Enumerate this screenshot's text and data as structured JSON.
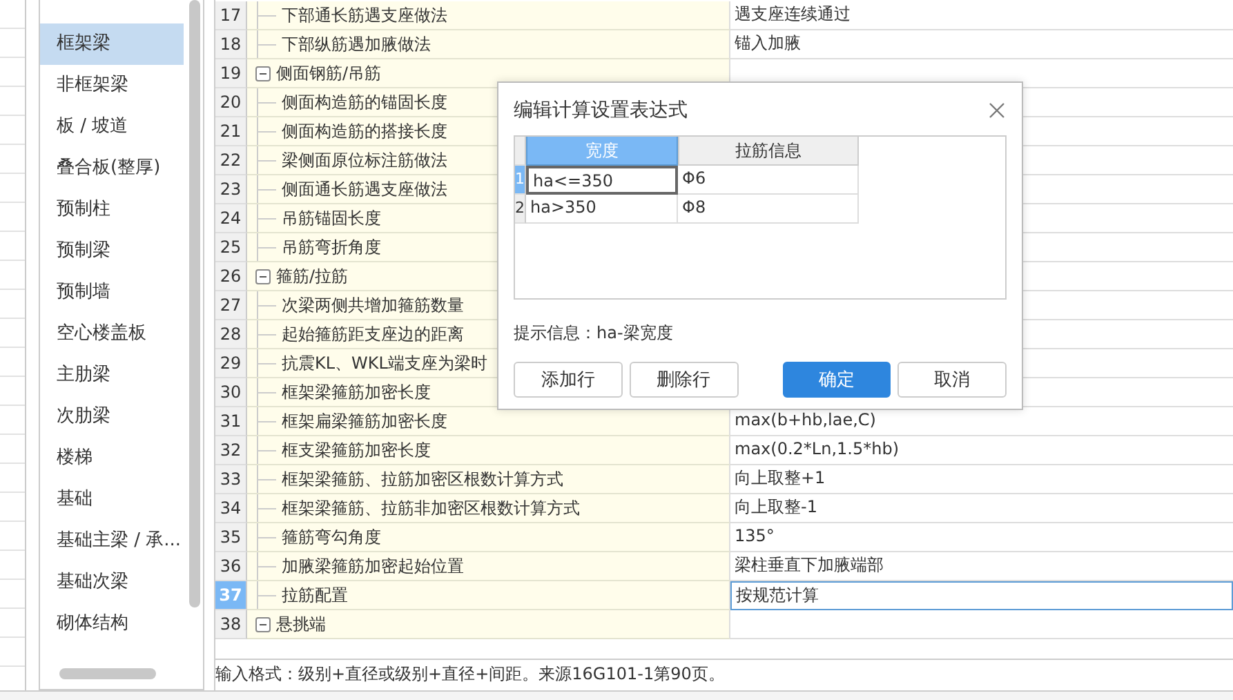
{
  "sidebar": {
    "items": [
      {
        "label": "框架梁",
        "selected": true
      },
      {
        "label": "非框架梁",
        "selected": false
      },
      {
        "label": "板 / 坡道",
        "selected": false
      },
      {
        "label": "叠合板(整厚)",
        "selected": false
      },
      {
        "label": "预制柱",
        "selected": false
      },
      {
        "label": "预制梁",
        "selected": false
      },
      {
        "label": "预制墙",
        "selected": false
      },
      {
        "label": "空心楼盖板",
        "selected": false
      },
      {
        "label": "主肋梁",
        "selected": false
      },
      {
        "label": "次肋梁",
        "selected": false
      },
      {
        "label": "楼梯",
        "selected": false
      },
      {
        "label": "基础",
        "selected": false
      },
      {
        "label": "基础主梁 / 承...",
        "selected": false
      },
      {
        "label": "基础次梁",
        "selected": false
      },
      {
        "label": "砌体结构",
        "selected": false
      }
    ]
  },
  "table": {
    "rows": [
      {
        "number": "17",
        "kind": "item",
        "name": "下部通长筋遇支座做法",
        "value": "遇支座连续通过",
        "selected": false
      },
      {
        "number": "18",
        "kind": "item",
        "name": "下部纵筋遇加腋做法",
        "value": "锚入加腋",
        "selected": false
      },
      {
        "number": "19",
        "kind": "group",
        "expanded": true,
        "name": "侧面钢筋/吊筋",
        "value": "",
        "selected": false
      },
      {
        "number": "20",
        "kind": "item",
        "name": "侧面构造筋的锚固长度",
        "value": "",
        "selected": false
      },
      {
        "number": "21",
        "kind": "item",
        "name": "侧面构造筋的搭接长度",
        "value": "",
        "selected": false
      },
      {
        "number": "22",
        "kind": "item",
        "name": "梁侧面原位标注筋做法",
        "value": "",
        "selected": false
      },
      {
        "number": "23",
        "kind": "item",
        "name": "侧面通长筋遇支座做法",
        "value": "",
        "selected": false
      },
      {
        "number": "24",
        "kind": "item",
        "name": "吊筋锚固长度",
        "value": "",
        "selected": false
      },
      {
        "number": "25",
        "kind": "item",
        "name": "吊筋弯折角度",
        "value": "",
        "selected": false
      },
      {
        "number": "26",
        "kind": "group",
        "expanded": true,
        "name": "箍筋/拉筋",
        "value": "",
        "selected": false
      },
      {
        "number": "27",
        "kind": "item",
        "name": "次梁两侧共增加箍筋数量",
        "value": "",
        "selected": false
      },
      {
        "number": "28",
        "kind": "item",
        "name": "起始箍筋距支座边的距离",
        "value": "",
        "selected": false
      },
      {
        "number": "29",
        "kind": "item",
        "name": "抗震KL、WKL端支座为梁时",
        "value": "",
        "selected": false
      },
      {
        "number": "30",
        "kind": "item",
        "name": "框架梁箍筋加密长度",
        "value": "",
        "selected": false
      },
      {
        "number": "31",
        "kind": "item",
        "name": "框架扁梁箍筋加密长度",
        "value": "max(b+hb,lae,C)",
        "selected": false
      },
      {
        "number": "32",
        "kind": "item",
        "name": "框支梁箍筋加密长度",
        "value": "max(0.2*Ln,1.5*hb)",
        "selected": false
      },
      {
        "number": "33",
        "kind": "item",
        "name": "框架梁箍筋、拉筋加密区根数计算方式",
        "value": "向上取整+1",
        "selected": false
      },
      {
        "number": "34",
        "kind": "item",
        "name": "框架梁箍筋、拉筋非加密区根数计算方式",
        "value": "向上取整-1",
        "selected": false
      },
      {
        "number": "35",
        "kind": "item",
        "name": "箍筋弯勾角度",
        "value": "135°",
        "selected": false
      },
      {
        "number": "36",
        "kind": "item",
        "name": "加腋梁箍筋加密起始位置",
        "value": "梁柱垂直下加腋端部",
        "selected": false
      },
      {
        "number": "37",
        "kind": "item",
        "name": "拉筋配置",
        "value": "按规范计算",
        "selected": true
      },
      {
        "number": "38",
        "kind": "group",
        "expanded": true,
        "name": "悬挑端",
        "value": "",
        "selected": false
      }
    ]
  },
  "status_bar": {
    "text": "输入格式：级别+直径或级别+直径+间距。来源16G101-1第90页。"
  },
  "dialog": {
    "title": "编辑计算设置表达式",
    "columns": [
      {
        "label": "宽度",
        "selected": true
      },
      {
        "label": "拉筋信息",
        "selected": false
      }
    ],
    "rows": [
      {
        "number": "1",
        "selected": true,
        "cells": [
          "ha<=350",
          "Φ6"
        ]
      },
      {
        "number": "2",
        "selected": false,
        "cells": [
          "ha>350",
          "Φ8"
        ]
      }
    ],
    "hint": "提示信息：ha-梁宽度",
    "buttons": [
      {
        "label": "添加行",
        "kind": "default"
      },
      {
        "label": "删除行",
        "kind": "default"
      },
      {
        "label": "确定",
        "kind": "primary"
      },
      {
        "label": "取消",
        "kind": "default"
      }
    ]
  }
}
